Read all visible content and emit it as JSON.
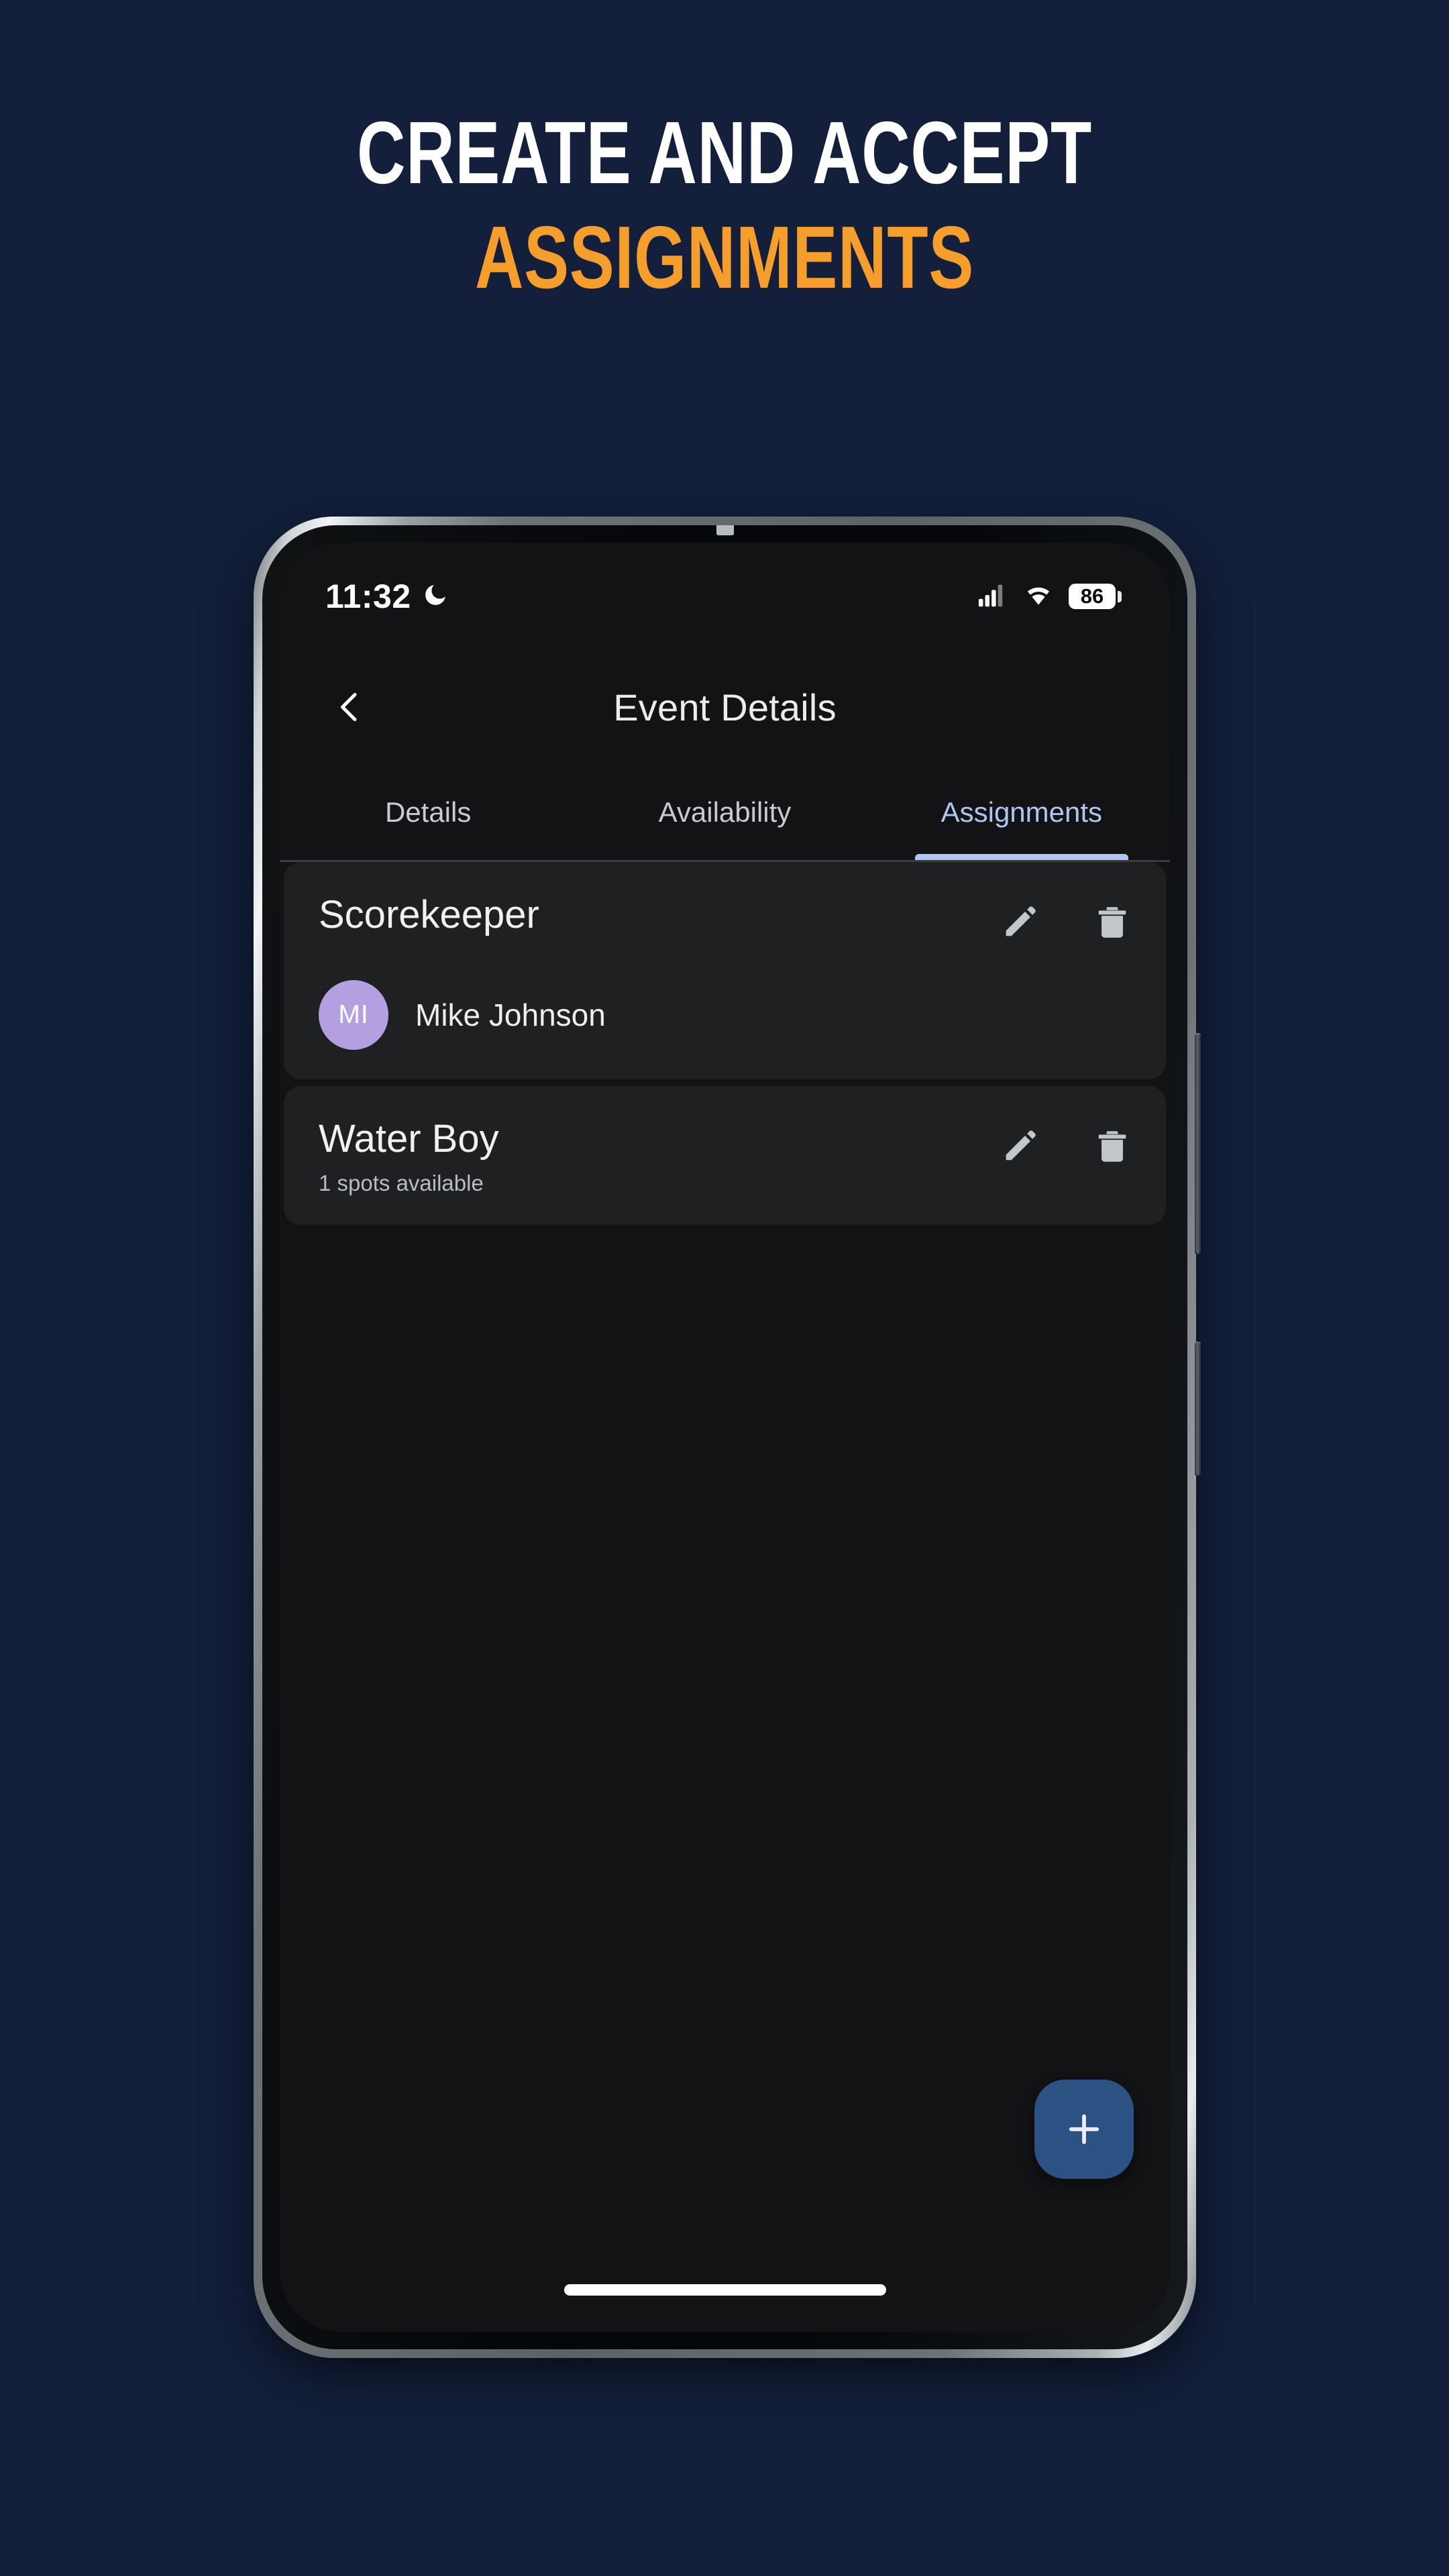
{
  "promo": {
    "line1": "CREATE AND ACCEPT",
    "line2": "ASSIGNMENTS",
    "line1_color": "#FFFFFF",
    "line2_color": "#F59E2B",
    "background_color": "#131F3B"
  },
  "status_bar": {
    "time": "11:32",
    "dnd_icon": "crescent-moon-icon",
    "signal_icon": "cellular-signal-icon",
    "wifi_icon": "wifi-icon",
    "battery_level": "86"
  },
  "app_bar": {
    "back_icon": "chevron-left-icon",
    "title": "Event Details"
  },
  "tabs": {
    "items": [
      {
        "label": "Details",
        "active": false
      },
      {
        "label": "Availability",
        "active": false
      },
      {
        "label": "Assignments",
        "active": true
      }
    ],
    "active_color": "#AFC6F0",
    "inactive_color": "#C9CBCE"
  },
  "assignments": {
    "cards": [
      {
        "title": "Scorekeeper",
        "subtitle": "",
        "edit_icon": "pencil-edit-icon",
        "delete_icon": "trash-delete-icon",
        "assignee": {
          "initials": "MI",
          "name": "Mike Johnson",
          "avatar_color": "#B4A0E0"
        }
      },
      {
        "title": "Water Boy",
        "subtitle": "1 spots available",
        "edit_icon": "pencil-edit-icon",
        "delete_icon": "trash-delete-icon",
        "assignee": null
      }
    ]
  },
  "fab": {
    "icon": "plus-icon",
    "color": "#2C5283"
  },
  "screen": {
    "background_color": "#131316",
    "card_color": "#1F2022"
  }
}
